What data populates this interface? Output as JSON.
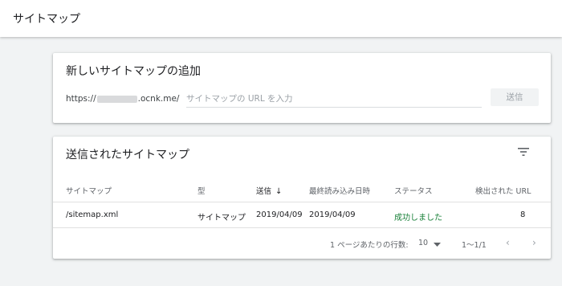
{
  "header": {
    "title": "サイトマップ"
  },
  "add_card": {
    "title": "新しいサイトマップの追加",
    "url_prefix": "https://",
    "url_suffix": ".ocnk.me/",
    "input_placeholder": "サイトマップの URL を入力",
    "submit_label": "送信"
  },
  "submitted_card": {
    "title": "送信されたサイトマップ",
    "filter_icon": "filter-icon",
    "columns": [
      "サイトマップ",
      "型",
      "送信",
      "最終読み込み日時",
      "ステータス",
      "検出された URL"
    ],
    "sort_column": "送信",
    "rows": [
      {
        "sitemap": "/sitemap.xml",
        "type": "サイトマップ",
        "submitted": "2019/04/09",
        "last_read": "2019/04/09",
        "status": "成功しました",
        "discovered_urls": "8"
      }
    ],
    "pagination": {
      "rows_per_page_label": "1 ページあたりの行数:",
      "rows_per_page_value": "10",
      "range": "1〜1/1"
    }
  },
  "colors": {
    "success": "#188038",
    "text": "#202124",
    "muted": "#5f6368"
  }
}
